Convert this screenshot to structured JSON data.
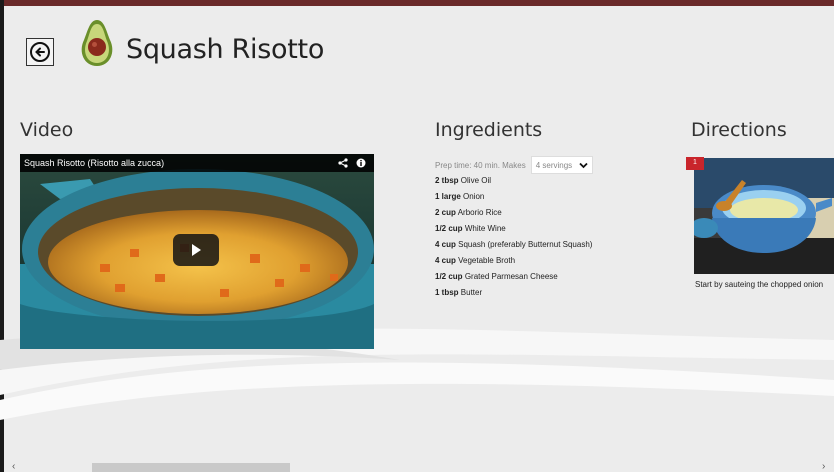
{
  "app": {
    "title": "Squash Risotto"
  },
  "sections": {
    "video_title": "Video",
    "ingredients_title": "Ingredients",
    "directions_title": "Directions"
  },
  "video": {
    "caption": "Squash Risotto (Risotto alla zucca)"
  },
  "ingredients": {
    "prep_label": "Prep time: 40 min. Makes",
    "servings": "4 servings",
    "items": [
      {
        "qty": "2 tbsp",
        "name": "Olive Oil"
      },
      {
        "qty": "1 large",
        "name": "Onion"
      },
      {
        "qty": "2 cup",
        "name": "Arborio Rice"
      },
      {
        "qty": "1/2 cup",
        "name": "White Wine"
      },
      {
        "qty": "4 cup",
        "name": "Squash (preferably Butternut Squash)"
      },
      {
        "qty": "4 cup",
        "name": "Vegetable Broth"
      },
      {
        "qty": "1/2 cup",
        "name": "Grated Parmesan Cheese"
      },
      {
        "qty": "1 tbsp",
        "name": "Butter"
      }
    ]
  },
  "directions": {
    "step_number": "1",
    "step_text": "Start by sauteing the chopped onion"
  },
  "scrollbar": {
    "left_arrow": "‹",
    "right_arrow": "›"
  }
}
